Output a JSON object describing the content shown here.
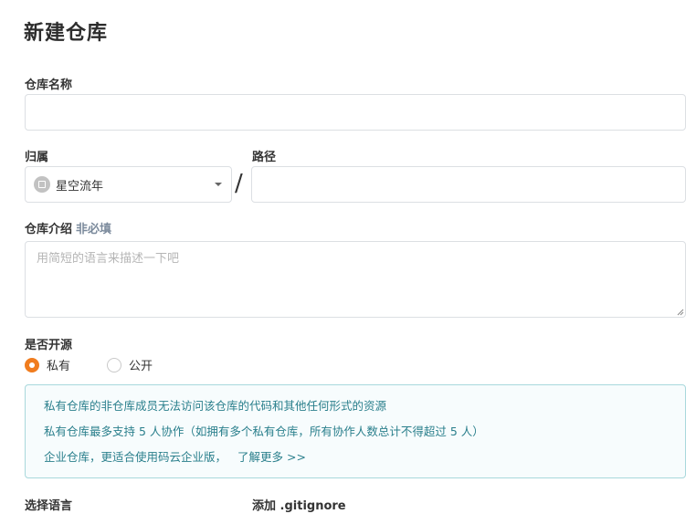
{
  "page": {
    "title": "新建仓库"
  },
  "repo_name": {
    "label": "仓库名称",
    "value": "",
    "placeholder": ""
  },
  "owner": {
    "label": "归属",
    "selected": "星空流年"
  },
  "path": {
    "label": "路径",
    "value": "",
    "placeholder": ""
  },
  "separator": "/",
  "description": {
    "label": "仓库介绍",
    "optional": "非必填",
    "placeholder": "用简短的语言来描述一下吧"
  },
  "open_source": {
    "label": "是否开源",
    "options": [
      {
        "label": "私有",
        "checked": true
      },
      {
        "label": "公开",
        "checked": false
      }
    ]
  },
  "notice": {
    "lines": [
      "私有仓库的非仓库成员无法访问该仓库的代码和其他任何形式的资源",
      "私有仓库最多支持 5 人协作（如拥有多个私有仓库，所有协作人数总计不得超过 5 人）",
      "企业仓库，更适合使用码云企业版，"
    ],
    "link": "了解更多 >>"
  },
  "language": {
    "label": "选择语言"
  },
  "gitignore": {
    "label": "添加 .gitignore"
  },
  "colors": {
    "accent": "#f07c1e",
    "notice_text": "#2a7f8c",
    "notice_border": "#a8d8dc",
    "notice_bg": "#f7fcfd"
  }
}
